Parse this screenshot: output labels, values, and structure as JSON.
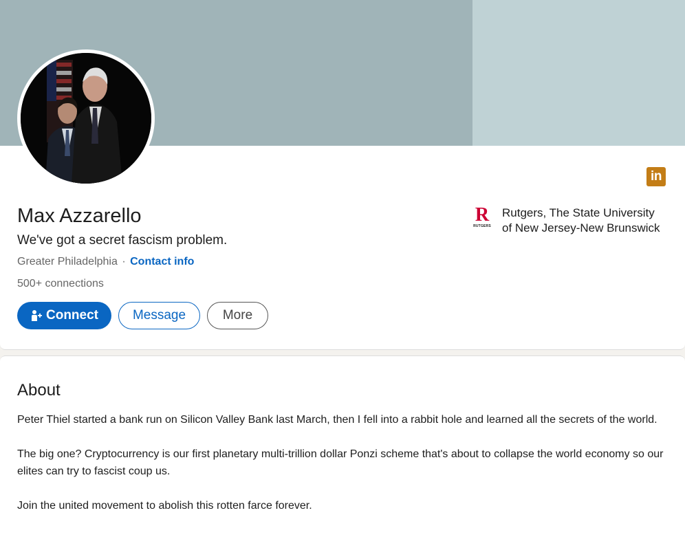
{
  "profile": {
    "name": "Max Azzarello",
    "headline": "We've got a secret fascism problem.",
    "location": "Greater Philadelphia",
    "separator": "·",
    "contact_info": "Contact info",
    "connections": "500+ connections"
  },
  "actions": {
    "connect": "Connect",
    "message": "Message",
    "more": "More"
  },
  "badge": {
    "text": "in",
    "color": "#c37d16",
    "icon": "linkedin-icon"
  },
  "education": {
    "logo_letter": "R",
    "logo_wordmark": "RUTGERS",
    "school_line1": "Rutgers, The State University",
    "school_line2": "of New Jersey-New Brunswick",
    "logo_color": "#cc0033"
  },
  "about": {
    "title": "About",
    "paragraphs": [
      "Peter Thiel started a bank run on Silicon Valley Bank last March, then I fell into a rabbit hole and learned all the secrets of the world.",
      "The big one? Cryptocurrency is our first planetary multi-trillion dollar Ponzi scheme that's about to collapse the world economy so our elites can try to fascist coup us.",
      "Join the united movement to abolish this rotten farce forever."
    ]
  },
  "colors": {
    "accent": "#0a66c2",
    "banner": "#a0b4b8",
    "banner_light": "#bfd2d5"
  }
}
